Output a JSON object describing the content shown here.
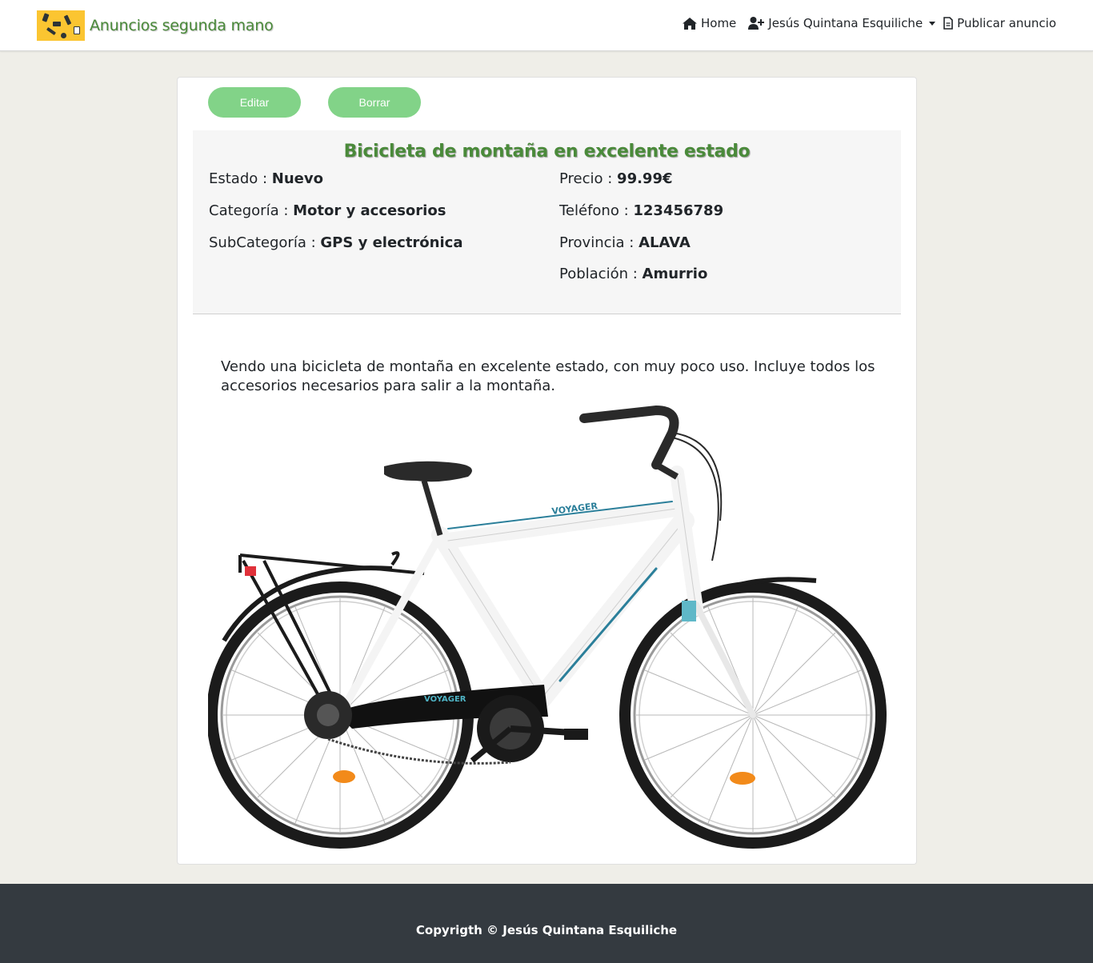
{
  "navbar": {
    "brand": "Anuncios segunda mano",
    "links": {
      "home": "Home",
      "user": "Jesús Quintana Esquiliche",
      "publish": "Publicar anuncio"
    }
  },
  "actions": {
    "edit": "Editar",
    "delete": "Borrar"
  },
  "listing": {
    "title": "Bicicleta de montaña en excelente estado",
    "estado": {
      "label": "Estado : ",
      "value": "Nuevo"
    },
    "categoria": {
      "label": "Categoría : ",
      "value": "Motor y accesorios"
    },
    "subcategoria": {
      "label": "SubCategoría : ",
      "value": "GPS y electrónica"
    },
    "precio": {
      "label": "Precio : ",
      "value": "99.99€"
    },
    "telefono": {
      "label": "Teléfono : ",
      "value": "123456789"
    },
    "provincia": {
      "label": "Provincia : ",
      "value": "ALAVA"
    },
    "poblacion": {
      "label": "Población : ",
      "value": "Amurrio"
    },
    "description": "Vendo una bicicleta de montaña en excelente estado, con muy poco uso. Incluye todos los accesorios necesarios para salir a la montaña.",
    "photo_brand_text": "VOYAGER"
  },
  "footer": {
    "copyright": "Copyrigth © Jesús Quintana Esquiliche"
  },
  "colors": {
    "accent_green": "#4a8a3a",
    "button_green": "#82d388",
    "footer_bg": "#343a40",
    "page_bg": "#efeee8"
  }
}
